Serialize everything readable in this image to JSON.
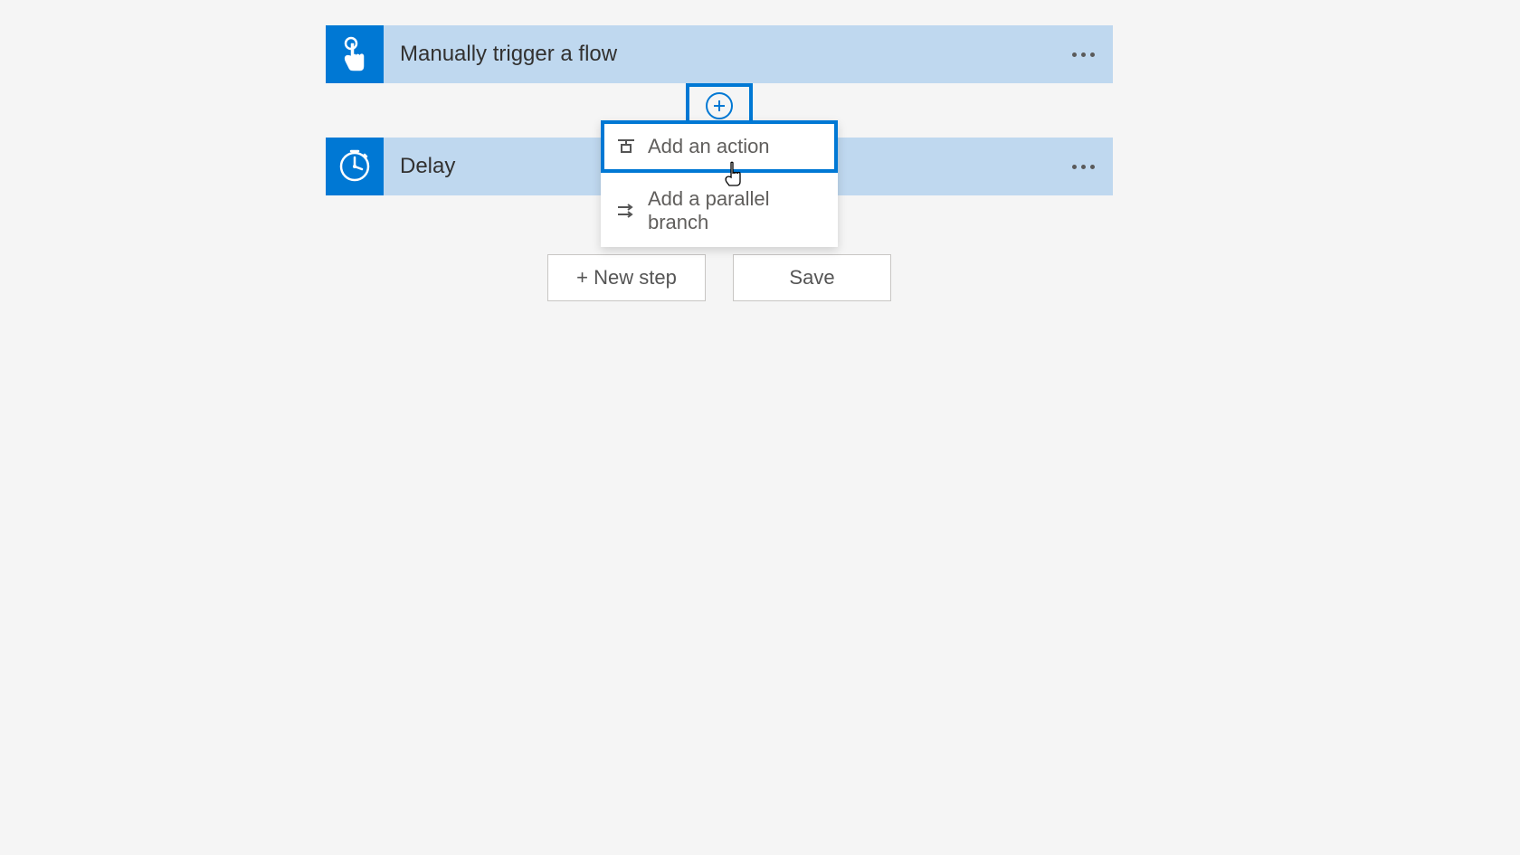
{
  "flow_cards": [
    {
      "title": "Manually trigger a flow",
      "icon": "touch-icon"
    },
    {
      "title": "Delay",
      "icon": "clock-icon"
    }
  ],
  "popup": {
    "items": [
      {
        "label": "Add an action",
        "icon": "insert-action-icon",
        "selected": true
      },
      {
        "label": "Add a parallel branch",
        "icon": "parallel-branch-icon",
        "selected": false
      }
    ]
  },
  "buttons": {
    "new_step": "+ New step",
    "save": "Save"
  }
}
